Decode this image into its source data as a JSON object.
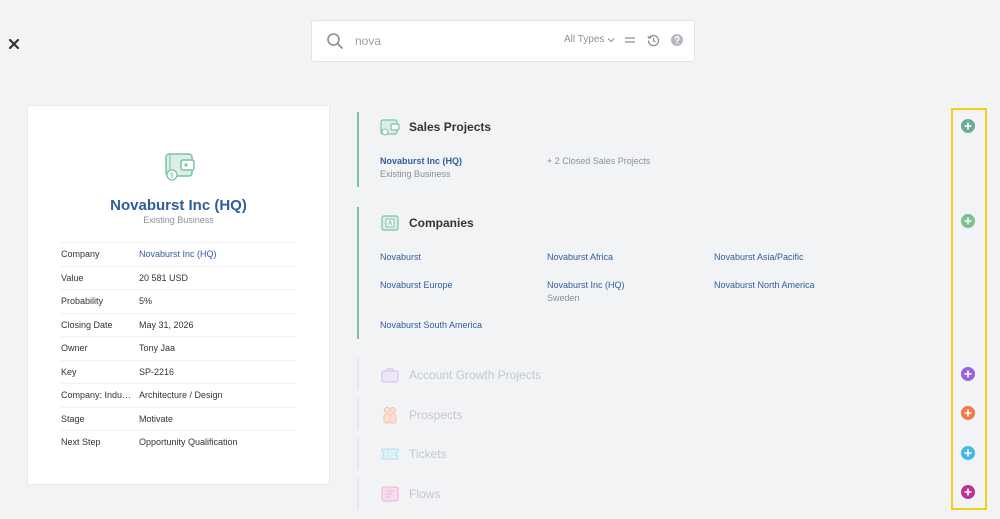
{
  "search": {
    "query": "nova",
    "types_label": "All Types",
    "icons": [
      "search-icon",
      "chevron-down-icon",
      "equals-icon",
      "history-icon",
      "help-icon"
    ]
  },
  "record": {
    "title": "Novaburst Inc (HQ)",
    "subtitle": "Existing Business",
    "icon": "wallet-icon",
    "fields": [
      {
        "label": "Company",
        "value": "Novaburst Inc (HQ)",
        "link": true
      },
      {
        "label": "Value",
        "value": "20 581 USD",
        "link": false
      },
      {
        "label": "Probability",
        "value": "5%",
        "link": false
      },
      {
        "label": "Closing Date",
        "value": "May 31, 2026",
        "link": false
      },
      {
        "label": "Owner",
        "value": "Tony Jaa",
        "link": false
      },
      {
        "label": "Key",
        "value": "SP-2216",
        "link": false
      },
      {
        "label": "Company: Industry",
        "value": "Architecture / Design",
        "link": false
      },
      {
        "label": "Stage",
        "value": "Motivate",
        "link": false
      },
      {
        "label": "Next Step",
        "value": "Opportunity Qualification",
        "link": false
      }
    ]
  },
  "sections": {
    "sales_projects": {
      "title": "Sales Projects",
      "item_name": "Novaburst Inc (HQ)",
      "item_sub": "Existing Business",
      "more": "+ 2 Closed Sales Projects"
    },
    "companies": {
      "title": "Companies",
      "items": [
        {
          "name": "Novaburst",
          "sub": ""
        },
        {
          "name": "Novaburst Africa",
          "sub": ""
        },
        {
          "name": "Novaburst Asia/Pacific",
          "sub": ""
        },
        {
          "name": "Novaburst Europe",
          "sub": ""
        },
        {
          "name": "Novaburst Inc (HQ)",
          "sub": "Sweden"
        },
        {
          "name": "Novaburst North America",
          "sub": ""
        },
        {
          "name": "Novaburst South America",
          "sub": ""
        }
      ]
    },
    "account_growth": {
      "title": "Account Growth Projects"
    },
    "prospects": {
      "title": "Prospects"
    },
    "tickets": {
      "title": "Tickets"
    },
    "flows": {
      "title": "Flows"
    }
  },
  "colors": {
    "accent_blue": "#2f5d9e",
    "section_green": "#7cc2a4",
    "add_sales": "#6aab96",
    "add_companies": "#7cbf93",
    "add_account_growth": "#9b63d6",
    "add_prospects": "#ef7a4a",
    "add_tickets": "#46b7e6",
    "add_flows": "#b8368f",
    "highlight": "#f3cf15"
  }
}
